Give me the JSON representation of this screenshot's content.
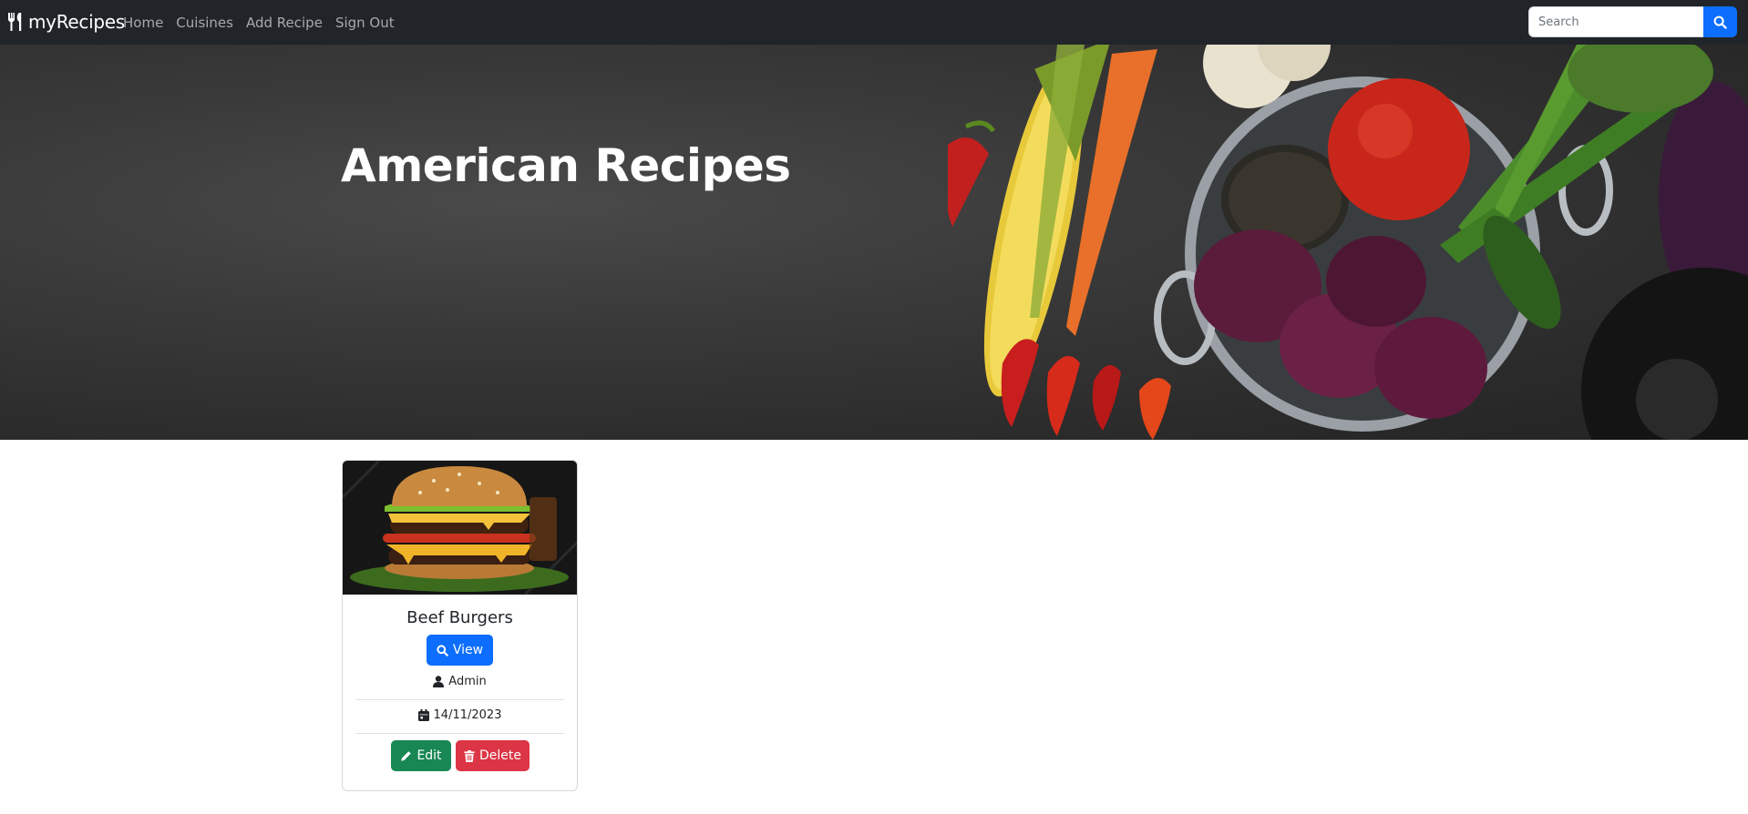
{
  "navbar": {
    "brand": "myRecipes",
    "links": [
      "Home",
      "Cuisines",
      "Add Recipe",
      "Sign Out"
    ],
    "search": {
      "placeholder": "Search",
      "value": ""
    }
  },
  "hero": {
    "title": "American Recipes"
  },
  "recipes": [
    {
      "title": "Beef Burgers",
      "view_label": "View",
      "author": "Admin",
      "date": "14/11/2023",
      "edit_label": "Edit",
      "delete_label": "Delete"
    }
  ],
  "colors": {
    "navbar": "#212529",
    "primary": "#0d6efd",
    "success": "#198754",
    "danger": "#dc3545"
  },
  "icons": {
    "brand": "utensils-icon",
    "search": "search-icon",
    "view": "search-icon",
    "author": "user-icon",
    "date": "calendar-icon",
    "edit": "pencil-icon",
    "delete": "trash-icon"
  }
}
